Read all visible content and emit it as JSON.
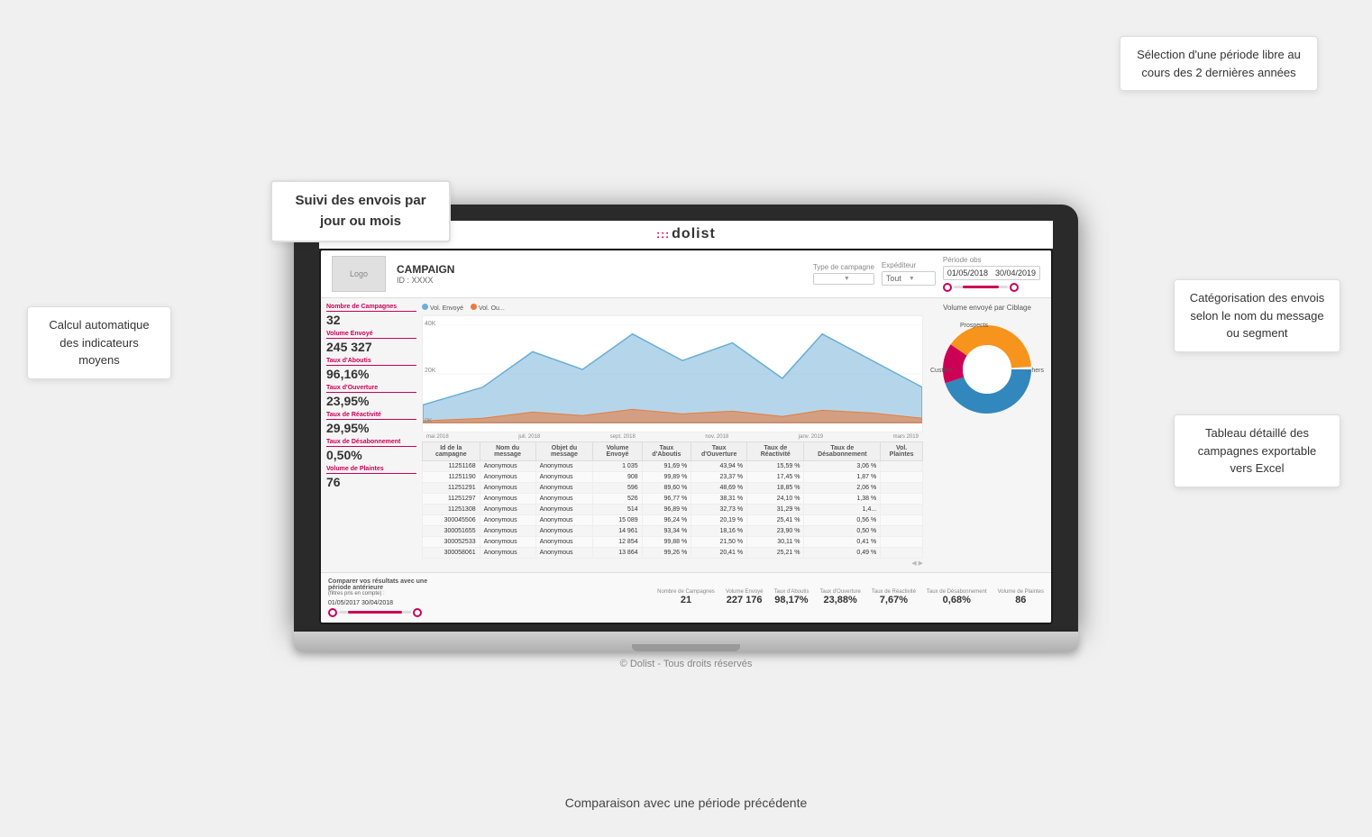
{
  "brand": {
    "name": "dolist",
    "dots": ":::"
  },
  "header": {
    "logo_label": "Logo",
    "campaign_title": "CAMPAIGN",
    "campaign_id": "ID : XXXX",
    "filters": {
      "type_label": "Type de campagne",
      "type_value": "",
      "expediteur_label": "Expéditeur",
      "expediteur_value": "Tout",
      "periode_label": "Période obs",
      "date_from": "01/05/2018",
      "date_to": "30/04/2019"
    }
  },
  "kpis": [
    {
      "label": "Nombre de Campagnes",
      "value": "32"
    },
    {
      "label": "Volume Envoyé",
      "value": "245 327"
    },
    {
      "label": "Taux d'Aboutis",
      "value": "96,16%"
    },
    {
      "label": "Taux d'Ouverture",
      "value": "23,95%"
    },
    {
      "label": "Taux de Réactivité",
      "value": "29,95%"
    },
    {
      "label": "Taux de Désabonnement",
      "value": "0,50%"
    },
    {
      "label": "Volume de Plaintes",
      "value": "76"
    }
  ],
  "chart": {
    "title": "Volume envoyé par Ciblage",
    "y_labels": [
      "40K",
      "20K",
      "0K"
    ],
    "x_labels": [
      "mai 2018",
      "juil. 2018",
      "sept. 2018",
      "nov. 2018",
      "janv. 2019",
      "mars 2019"
    ],
    "legend": [
      {
        "label": "Vol. Envoyé",
        "color": "#6baed6"
      },
      {
        "label": "Vol. Ou...",
        "color": "#e87a3c"
      }
    ]
  },
  "donut": {
    "title": "Volume envoyé par Ciblage",
    "segments": [
      {
        "label": "Prospects",
        "color": "#3288bd",
        "percent": 45
      },
      {
        "label": "Custom...",
        "color": "#cc0055",
        "percent": 15
      },
      {
        "label": "Others",
        "color": "#f7941d",
        "percent": 40
      }
    ]
  },
  "table": {
    "headers": [
      "Id de la campagne",
      "Nom du message",
      "Objet du message",
      "Volume Envoyé",
      "Taux d'Aboutis",
      "Taux d'Ouverture",
      "Taux de Réactivité",
      "Taux de Désabonnement",
      "Vol. Plaintes"
    ],
    "rows": [
      [
        "11251168",
        "Anonymous",
        "Anonymous",
        "1 035",
        "91,69 %",
        "43,94 %",
        "15,59 %",
        "3,06 %",
        ""
      ],
      [
        "11251190",
        "Anonymous",
        "Anonymous",
        "908",
        "99,89 %",
        "23,37 %",
        "17,45 %",
        "1,87 %",
        ""
      ],
      [
        "11251291",
        "Anonymous",
        "Anonymous",
        "596",
        "89,60 %",
        "48,69 %",
        "18,85 %",
        "2,06 %",
        ""
      ],
      [
        "11251297",
        "Anonymous",
        "Anonymous",
        "526",
        "96,77 %",
        "38,31 %",
        "24,10 %",
        "1,38 %",
        ""
      ],
      [
        "11251308",
        "Anonymous",
        "Anonymous",
        "514",
        "96,89 %",
        "32,73 %",
        "31,29 %",
        "1,4...",
        ""
      ],
      [
        "300045506",
        "Anonymous",
        "Anonymous",
        "15 089",
        "96,24 %",
        "20,19 %",
        "25,41 %",
        "0,56 %",
        ""
      ],
      [
        "300051655",
        "Anonymous",
        "Anonymous",
        "14 961",
        "93,34 %",
        "18,16 %",
        "23,90 %",
        "0,50 %",
        ""
      ],
      [
        "300052533",
        "Anonymous",
        "Anonymous",
        "12 854",
        "99,88 %",
        "21,50 %",
        "30,11 %",
        "0,41 %",
        ""
      ],
      [
        "300058061",
        "Anonymous",
        "Anonymous",
        "13 864",
        "99,26 %",
        "20,41 %",
        "25,21 %",
        "0,49 %",
        ""
      ]
    ]
  },
  "comparison": {
    "label": "Comparer vos résultats avec une période antérieure",
    "sublabel": "(filtres pris en compte) :",
    "date_from": "01/05/2017",
    "date_to": "30/04/2018",
    "metrics": [
      {
        "label": "Nombre de Campagnes",
        "value": "21"
      },
      {
        "label": "Volume Envoyé",
        "value": "227 176"
      },
      {
        "label": "Taux d'Aboutis",
        "value": "98,17%"
      },
      {
        "label": "Taux d'Ouverture",
        "value": "23,88%"
      },
      {
        "label": "Taux de Réactivité",
        "value": "7,67%"
      },
      {
        "label": "Taux de Désabonnement",
        "value": "0,68%"
      },
      {
        "label": "Volume de Plaintes",
        "value": "86"
      }
    ]
  },
  "annotations": {
    "top_right": "Sélection d'une période libre au cours des 2 dernières années",
    "left": "Calcul automatique des indicateurs moyens",
    "center_popup": "Suivi des envois par jour ou mois",
    "right_mid": "Catégorisation des envois selon le nom du message ou segment",
    "right_bottom_label": "Tableau détaillé des campagnes exportable vers Excel",
    "bottom_center": "Comparaison avec une période précédente"
  },
  "footer": "© Dolist - Tous droits réservés"
}
